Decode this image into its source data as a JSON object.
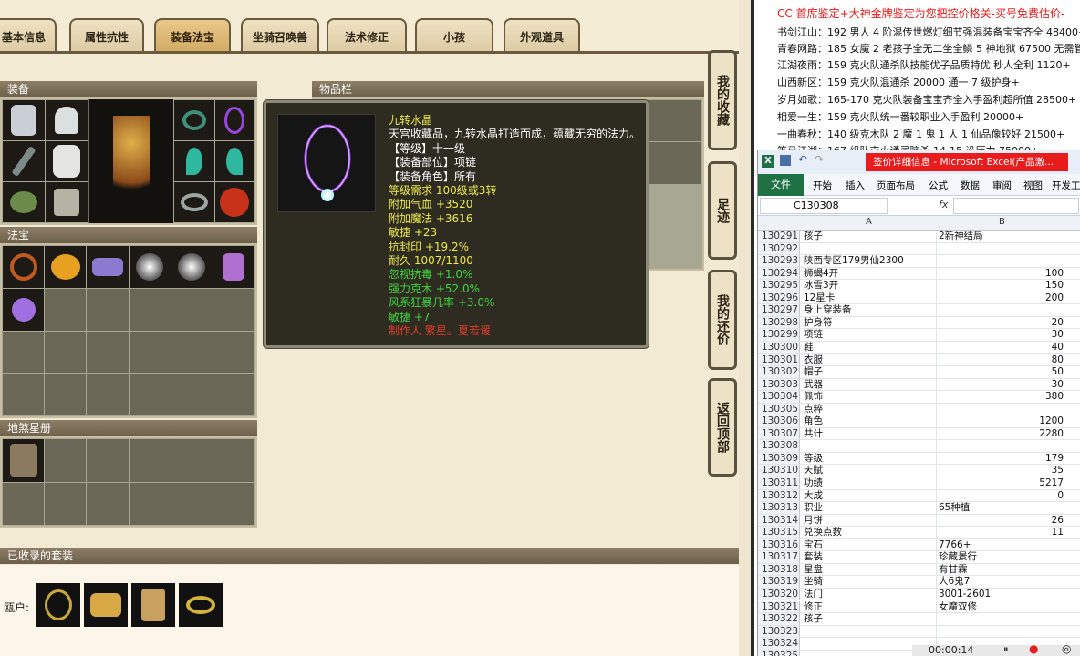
{
  "game": {
    "tabs": [
      "基本信息",
      "属性抗性",
      "装备法宝",
      "坐骑召唤兽",
      "法术修正",
      "小孩",
      "外观道具"
    ],
    "active_tab": "装备法宝",
    "sections": {
      "equipment": "装备",
      "inventory": "物品栏",
      "treasures": "法宝",
      "star_book": "地煞星册",
      "collected_sets": "已收录的套装",
      "house_label": "瓯户:"
    },
    "side_buttons": [
      "我的收藏",
      "足迹",
      "我的还价",
      "返回顶部"
    ],
    "tooltip": {
      "name": "九转水晶",
      "desc": "天宫收藏品，九转水晶打造而成，蕴藏无穷的法力。",
      "level": "【等级】十一级",
      "slot": "【装备部位】项链",
      "role": "【装备角色】所有",
      "req": "等级需求 100级或3转",
      "hp": "附加气血 +3520",
      "mp": "附加魔法 +3616",
      "agi": "敏捷 +23",
      "seal": "抗封印 +19.2%",
      "durability": "耐久 1007/1100",
      "b1": "忽视抗毒 +1.0%",
      "b2": "强力克木 +52.0%",
      "b3": "风系狂暴几率 +3.0%",
      "b4": "敏捷 +7",
      "maker": "制作人 繁星。夏若谖"
    }
  },
  "news": [
    "CC 首席鉴定+大神金牌鉴定为您把控价格关-买号免费估价-",
    "书剑江山：192 男人 4 阶混传世燃灯细节强混装备宝宝齐全 48400+",
    "青春网路：185 女魔 2 老孩子全无二坐全鳞 5 神地狱 67500 无需管退-",
    "江湖夜雨：159 克火队通杀队技能优子品质特优 秒人全利 1120+",
    "山西新区：159 克火队混通杀 20000 通一 7 级护身+",
    "岁月如歌：165-170 克火队装备宝宝齐全入手盈利超所值 28500+",
    "相爱一生：159 克火队统一番较职业入手盈利 20000+",
    "一曲春秋：140 级克木队 2 魔 1 鬼 1 人 1 仙品像较好 21500+",
    "策马江湖：167 组队克火通灵脑杀 14-15 没压力 75000+"
  ],
  "excel": {
    "title": "签价详细信息 - Microsoft Excel(产品激...",
    "file_tab": "文件",
    "ribbon": [
      "开始",
      "插入",
      "页面布局",
      "公式",
      "数据",
      "审阅",
      "视图",
      "开发工"
    ],
    "name_box": "C130308",
    "fx": "fx",
    "col_a": "A",
    "col_b": "B",
    "rows": [
      {
        "n": "130291",
        "a": "孩子",
        "b": "2新神结局"
      },
      {
        "n": "130292",
        "a": "",
        "b": ""
      },
      {
        "n": "130293",
        "a": "陕西专区179男仙2300",
        "b": ""
      },
      {
        "n": "130294",
        "a": "狮蝎4开",
        "b": "100"
      },
      {
        "n": "130295",
        "a": "冰雪3开",
        "b": "150"
      },
      {
        "n": "130296",
        "a": "12星卡",
        "b": "200"
      },
      {
        "n": "130297",
        "a": "身上穿装备",
        "b": ""
      },
      {
        "n": "130298",
        "a": "护身符",
        "b": "20"
      },
      {
        "n": "130299",
        "a": "项链",
        "b": "30"
      },
      {
        "n": "130300",
        "a": "鞋",
        "b": "40"
      },
      {
        "n": "130301",
        "a": "衣服",
        "b": "80"
      },
      {
        "n": "130302",
        "a": "帽子",
        "b": "50"
      },
      {
        "n": "130303",
        "a": "武器",
        "b": "30"
      },
      {
        "n": "130304",
        "a": "佩饰",
        "b": "380"
      },
      {
        "n": "130305",
        "a": "点粹",
        "b": ""
      },
      {
        "n": "130306",
        "a": "角色",
        "b": "1200"
      },
      {
        "n": "130307",
        "a": "共计",
        "b": "2280"
      },
      {
        "n": "130308",
        "a": "",
        "b": ""
      },
      {
        "n": "130309",
        "a": "等级",
        "b": "179"
      },
      {
        "n": "130310",
        "a": "天賦",
        "b": "35"
      },
      {
        "n": "130311",
        "a": "功绩",
        "b": "5217"
      },
      {
        "n": "130312",
        "a": "大成",
        "b": "0"
      },
      {
        "n": "130313",
        "a": "职业",
        "b": "65种植"
      },
      {
        "n": "130314",
        "a": "月饼",
        "b": "26"
      },
      {
        "n": "130315",
        "a": "兑换点数",
        "b": "11"
      },
      {
        "n": "130316",
        "a": "宝石",
        "b": "7766+"
      },
      {
        "n": "130317",
        "a": "套装",
        "b": "珍藏景行"
      },
      {
        "n": "130318",
        "a": "星盘",
        "b": "有甘霖"
      },
      {
        "n": "130319",
        "a": "坐骑",
        "b": "人6鬼7"
      },
      {
        "n": "130320",
        "a": "法门",
        "b": "3001-2601"
      },
      {
        "n": "130321",
        "a": "修正",
        "b": "女魔双修"
      },
      {
        "n": "130322",
        "a": "孩子",
        "b": ""
      },
      {
        "n": "130323",
        "a": "",
        "b": ""
      },
      {
        "n": "130324",
        "a": "",
        "b": ""
      },
      {
        "n": "130325",
        "a": "",
        "b": ""
      }
    ]
  },
  "recorder": {
    "time": "00:00:14"
  },
  "colors": {
    "tab_active": "#d2aa63",
    "tooltip_bg": "#2e2b21",
    "excel_green": "#1e7145",
    "news_red": "#e81c1c"
  }
}
